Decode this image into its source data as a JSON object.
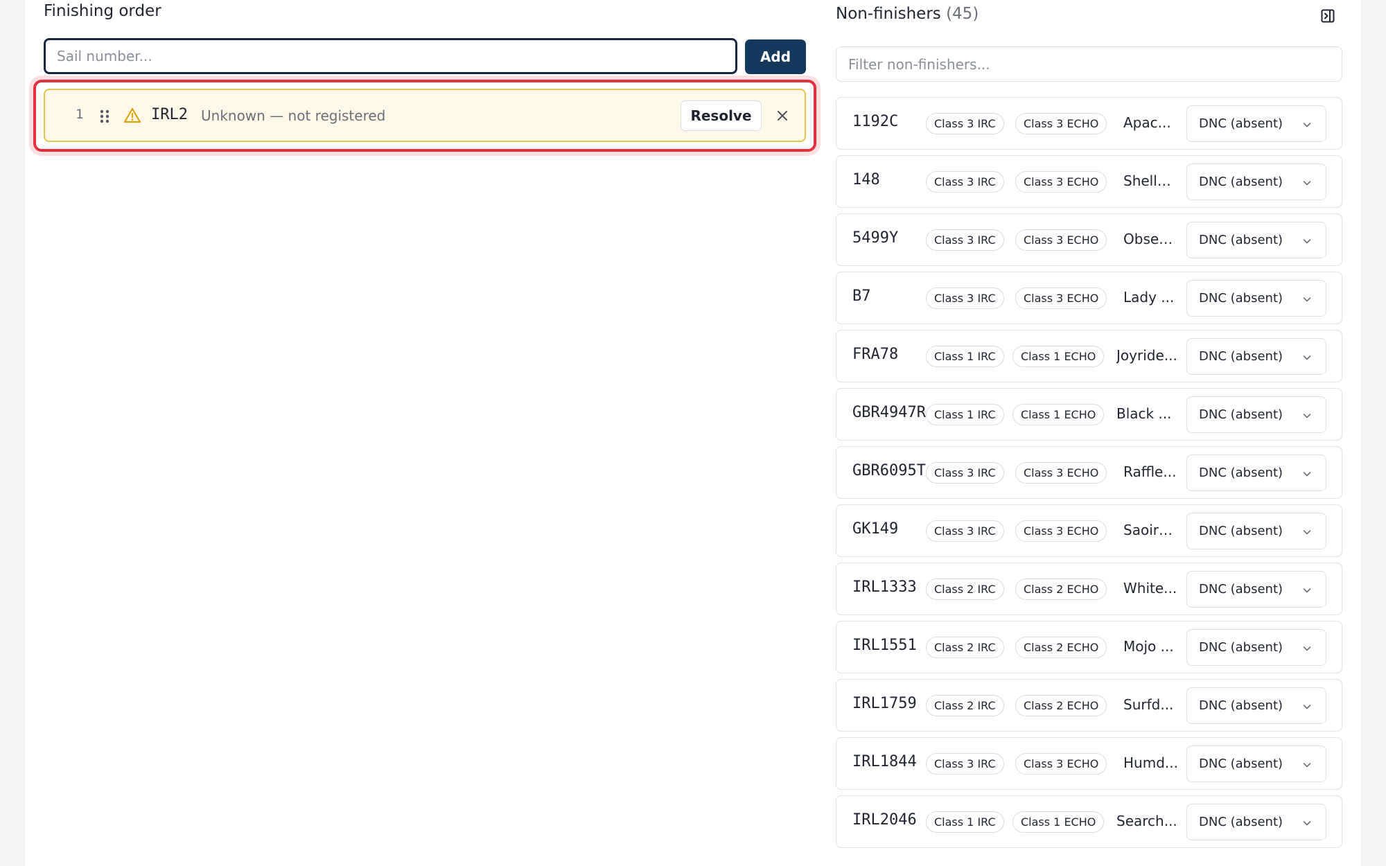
{
  "finishing": {
    "title": "Finishing order",
    "input_placeholder": "Sail number...",
    "input_value": "",
    "add_label": "Add",
    "items": [
      {
        "position": "1",
        "sail": "IRL2",
        "status": "Unknown — not registered",
        "resolve_label": "Resolve"
      }
    ]
  },
  "nonfinishers": {
    "title": "Non-finishers",
    "count": "(45)",
    "filter_placeholder": "Filter non-finishers...",
    "rows": [
      {
        "sail": "1192C",
        "irc": "Class 3 IRC",
        "echo": "Class 3 ECHO",
        "name": "Apac...",
        "status": "DNC (absent)"
      },
      {
        "sail": "148",
        "irc": "Class 3 IRC",
        "echo": "Class 3 ECHO",
        "name": "Shelly ...",
        "status": "DNC (absent)"
      },
      {
        "sail": "5499Y",
        "irc": "Class 3 IRC",
        "echo": "Class 3 ECHO",
        "name": "Obses...",
        "status": "DNC (absent)"
      },
      {
        "sail": "B7",
        "irc": "Class 3 IRC",
        "echo": "Class 3 ECHO",
        "name": "Lady ...",
        "status": "DNC (absent)"
      },
      {
        "sail": "FRA78",
        "irc": "Class 1 IRC",
        "echo": "Class 1 ECHO",
        "name": "Joyride...",
        "status": "DNC (absent)"
      },
      {
        "sail": "GBR4947R",
        "irc": "Class 1 IRC",
        "echo": "Class 1 ECHO",
        "name": "Black ...",
        "status": "DNC (absent)"
      },
      {
        "sail": "GBR6095T",
        "irc": "Class 3 IRC",
        "echo": "Class 3 ECHO",
        "name": "Raffle...",
        "status": "DNC (absent)"
      },
      {
        "sail": "GK149",
        "irc": "Class 3 IRC",
        "echo": "Class 3 ECHO",
        "name": "Saoirs...",
        "status": "DNC (absent)"
      },
      {
        "sail": "IRL1333",
        "irc": "Class 2 IRC",
        "echo": "Class 2 ECHO",
        "name": "White...",
        "status": "DNC (absent)"
      },
      {
        "sail": "IRL1551",
        "irc": "Class 2 IRC",
        "echo": "Class 2 ECHO",
        "name": "Mojo ...",
        "status": "DNC (absent)"
      },
      {
        "sail": "IRL1759",
        "irc": "Class 2 IRC",
        "echo": "Class 2 ECHO",
        "name": "Surfd...",
        "status": "DNC (absent)"
      },
      {
        "sail": "IRL1844",
        "irc": "Class 3 IRC",
        "echo": "Class 3 ECHO",
        "name": "Humd...",
        "status": "DNC (absent)"
      },
      {
        "sail": "IRL2046",
        "irc": "Class 1 IRC",
        "echo": "Class 1 ECHO",
        "name": "Search...",
        "status": "DNC (absent)"
      }
    ]
  },
  "icons": {
    "drag": "drag-handle-icon",
    "warning": "warning-icon",
    "remove": "close-icon",
    "collapse": "collapse-panel-icon",
    "chevron": "chevron-down-icon"
  },
  "colors": {
    "primary": "#133a5e",
    "warning_bg": "#fdf8e7",
    "warning_border": "#e6c44a",
    "highlight": "#e2313d"
  }
}
